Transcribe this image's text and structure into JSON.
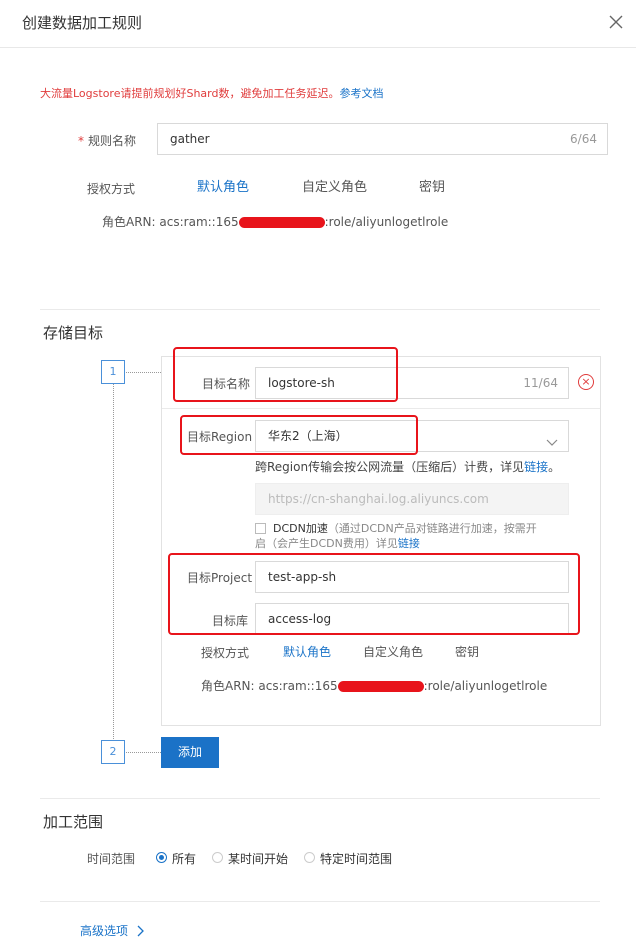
{
  "dialog": {
    "title": "创建数据加工规则",
    "close_icon": "close-icon"
  },
  "warning": {
    "text": "大流量Logstore请提前规划好Shard数，避免加工任务延迟。",
    "link": "参考文档",
    "color": "#e03c3c"
  },
  "rule": {
    "name_label": "规则名称",
    "required_mark": "*",
    "name_value": "gather",
    "name_counter": "6/64",
    "auth_label": "授权方式",
    "auth_tabs": [
      "默认角色",
      "自定义角色",
      "密钥"
    ],
    "auth_active": "默认角色",
    "arn_label": "角色ARN:",
    "arn_prefix": "acs:ram::165",
    "arn_suffix": ":role/aliyunlogetlrole"
  },
  "storage": {
    "section_title": "存储目标",
    "step1": "1",
    "step2": "2",
    "target_name_label": "目标名称",
    "target_name_value": "logstore-sh",
    "target_name_counter": "11/64",
    "region_label": "目标Region",
    "region_value": "华东2（上海）",
    "region_hint": "跨Region传输会按公网流量（压缩后）计费，详见",
    "region_hint_link": "链接",
    "region_hint_end": "。",
    "endpoint_value": "https://cn-shanghai.log.aliyuncs.com",
    "dcdn_label": "DCDN加速",
    "dcdn_desc_1": "（通过DCDN产品对链路进行加速，按需开",
    "dcdn_desc_2": "启（会产生DCDN费用）详见",
    "dcdn_link": "链接",
    "project_label": "目标Project",
    "project_value": "test-app-sh",
    "store_label": "目标库",
    "store_value": "access-log",
    "auth_label": "授权方式",
    "auth_tabs": [
      "默认角色",
      "自定义角色",
      "密钥"
    ],
    "auth_active": "默认角色",
    "arn_label": "角色ARN:",
    "arn_prefix": "acs:ram::165",
    "arn_suffix": ":role/aliyunlogetlrole",
    "add_button": "添加",
    "delete_icon": "close-circle-icon",
    "annotation_color": "#e8141b"
  },
  "range": {
    "section_title": "加工范围",
    "time_label": "时间范围",
    "options": [
      "所有",
      "某时间开始",
      "特定时间范围"
    ],
    "selected": "所有"
  },
  "advanced": {
    "label": "高级选项",
    "icon": "chevron-right-icon"
  },
  "colors": {
    "accent": "#1a73c8",
    "danger": "#e03c3c",
    "button": "#1b72c7"
  }
}
